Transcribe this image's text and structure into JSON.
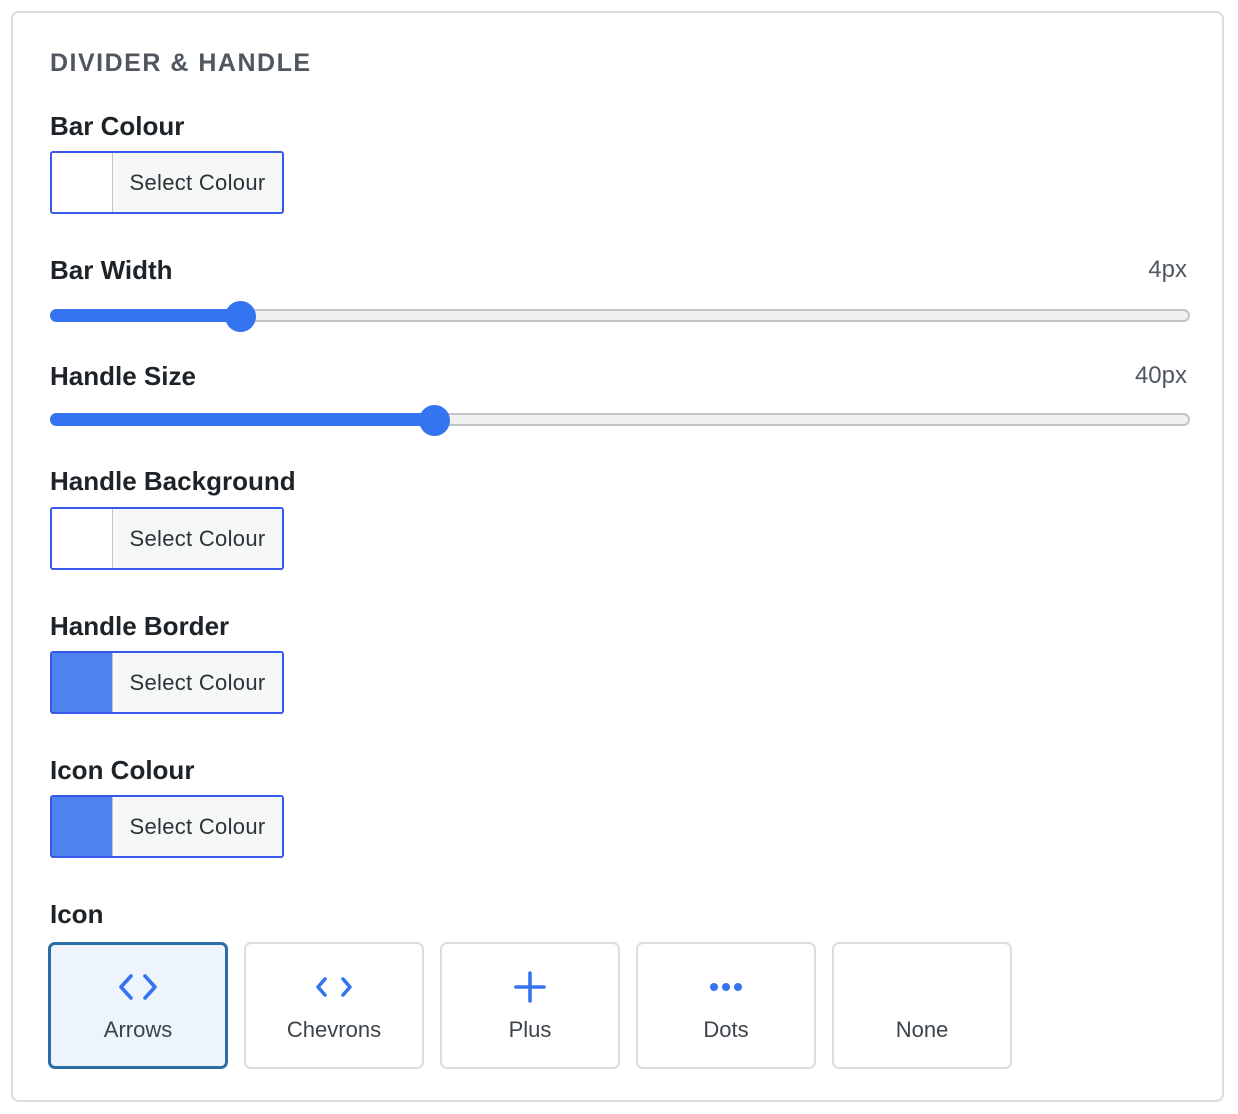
{
  "section_title": "DIVIDER & HANDLE",
  "accent_color": "#3574f0",
  "bar_colour": {
    "label": "Bar Colour",
    "button": "Select Colour",
    "swatch": "#ffffff"
  },
  "bar_width": {
    "label": "Bar Width",
    "value_text": "4px",
    "fill_fraction": 0.167
  },
  "handle_size": {
    "label": "Handle Size",
    "value_text": "40px",
    "fill_fraction": 0.337
  },
  "handle_background": {
    "label": "Handle Background",
    "button": "Select Colour",
    "swatch": "#ffffff"
  },
  "handle_border": {
    "label": "Handle Border",
    "button": "Select Colour",
    "swatch": "#4f82ec"
  },
  "icon_colour": {
    "label": "Icon Colour",
    "button": "Select Colour",
    "swatch": "#4f82ec"
  },
  "icon": {
    "label": "Icon",
    "selected": "arrows",
    "options": [
      {
        "id": "arrows",
        "label": "Arrows",
        "icon": "arrows-icon"
      },
      {
        "id": "chevrons",
        "label": "Chevrons",
        "icon": "chevrons-icon"
      },
      {
        "id": "plus",
        "label": "Plus",
        "icon": "plus-icon"
      },
      {
        "id": "dots",
        "label": "Dots",
        "icon": "dots-icon"
      },
      {
        "id": "none",
        "label": "None",
        "icon": ""
      }
    ]
  }
}
